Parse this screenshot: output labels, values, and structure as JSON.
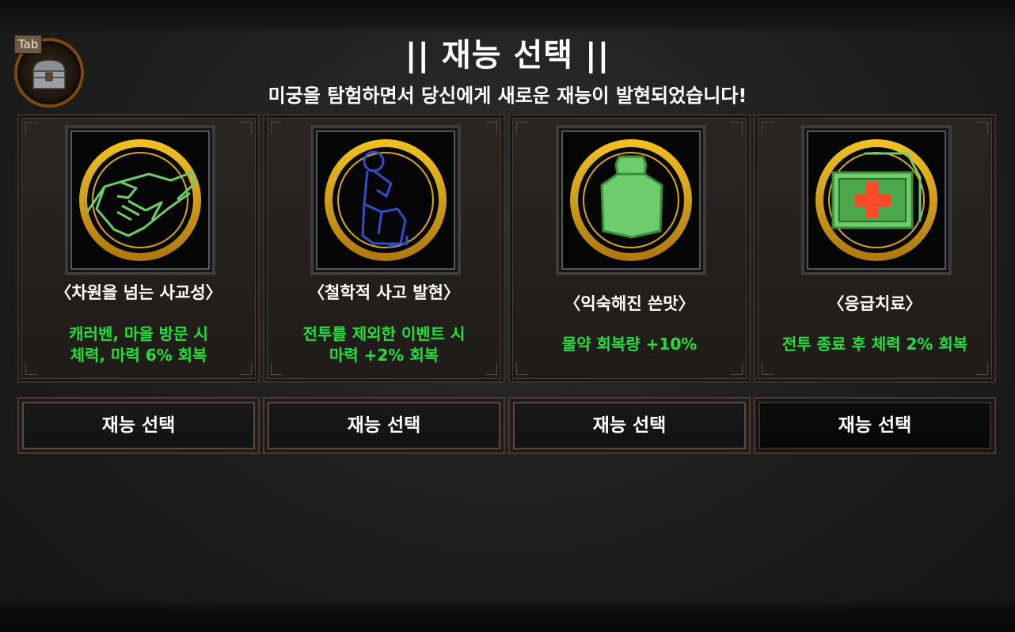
{
  "header": {
    "title": "|| 재능 선택 ||",
    "subtitle": "미궁을 탐험하면서 당신에게 새로운 재능이 발현되었습니다!"
  },
  "inventory": {
    "tab_label": "Tab",
    "icon": "chest-icon"
  },
  "talents": [
    {
      "name": "〈차원을 넘는 사교성〉",
      "desc_line1": "캐러벤, 마을 방문 시",
      "desc_line2": "체력, 마력 6% 회복",
      "icon": "handshake-icon",
      "button": "재능 선택"
    },
    {
      "name": "〈철학적 사고 발현〉",
      "desc_line1": "전투를 제외한 이벤트 시",
      "desc_line2": "마력 +2% 회복",
      "icon": "thinker-icon",
      "button": "재능 선택"
    },
    {
      "name": "〈익숙해진 쓴맛〉",
      "desc_line1": "물약 회복량 +10%",
      "desc_line2": "",
      "icon": "potion-icon",
      "button": "재능 선택"
    },
    {
      "name": "〈응급치료〉",
      "desc_line1": "전투 종료 후 체력 2% 회복",
      "desc_line2": "",
      "icon": "first-aid-kit-icon",
      "button": "재능 선택"
    }
  ],
  "colors": {
    "desc_text": "#22e03a",
    "ring_gold": "#e0b020",
    "icon_green": "#6ccd6a",
    "icon_blue": "#2f4fc8",
    "cross_red": "#ff4a2a"
  }
}
